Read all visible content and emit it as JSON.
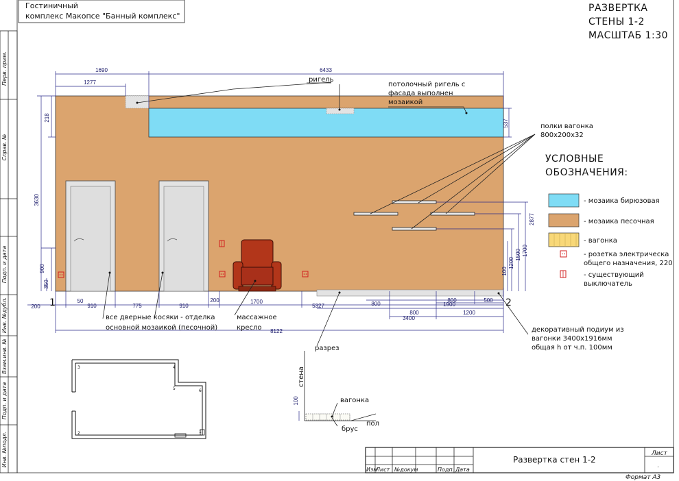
{
  "header": {
    "project_line1": "Гостиничный",
    "project_line2": "комплекс Макопсе \"Банный комплекс\"",
    "title_line1": "РАЗВЕРТКА",
    "title_line2": "СТЕНЫ 1-2",
    "title_line3": "МАСШТАБ 1:30"
  },
  "side_stamps": [
    "Перв. прим.",
    "Справ. №",
    "Подп. и дата",
    "Инв. №дубл.",
    "Взам.инв. №",
    "Подп. и дата",
    "Инв. №подл."
  ],
  "annotations": {
    "rigel": "ригель",
    "ceiling_line1": "потолочный ригель с",
    "ceiling_line2": "фасада выполнен",
    "ceiling_line3": "мозаикой",
    "shelves_line1": "полки вагонка",
    "shelves_line2": "800х200х32",
    "doors_line1": "все дверные косяки - отделка",
    "doors_line2": "основной мозаикой (песочной)",
    "chair_line1": "массажное",
    "chair_line2": "кресло",
    "podium_line1": "декоративный подиум из",
    "podium_line2": "вагонки 3400х1916мм",
    "podium_line3": "общая h от ч.п. 100мм",
    "section_label": "разрез",
    "section_wall": "стена",
    "section_lining": "вагонка",
    "section_beam": "брус",
    "section_floor": "пол",
    "section_100": "100",
    "point1": "1",
    "point2": "2"
  },
  "legend": {
    "title_line1": "УСЛОВНЫЕ",
    "title_line2": "ОБОЗНАЧЕНИЯ:",
    "items": [
      {
        "label": "- мозаика бирюзовая",
        "color": "#7fdcf5"
      },
      {
        "label": "- мозаика песочная",
        "color": "#dba46e"
      },
      {
        "label": "- вагонка",
        "color": "#f8d878"
      }
    ],
    "socket_line1": "- розетка электрическа",
    "socket_line2": "общего назначения, 220",
    "switch_line1": "- существующий",
    "switch_line2": "выключатель"
  },
  "dimensions": {
    "d1690": "1690",
    "d6433": "6433",
    "d1277": "1277",
    "d218": "218",
    "d537": "537",
    "d3630": "3630",
    "d900": "900",
    "d350": "350",
    "d200a": "200",
    "d50": "50",
    "d910a": "910",
    "d775": "775",
    "d910b": "910",
    "d200b": "200",
    "d1700": "1700",
    "d5327": "5327",
    "d8122": "8122",
    "d800a": "800",
    "d800b": "800",
    "d800c": "800",
    "d500": "500",
    "d1900": "1900",
    "d1200": "1200",
    "d3400": "3400",
    "d2877": "2877",
    "d1700v": "1700",
    "d1500": "1500",
    "d1200v": "1200",
    "d100": "100"
  },
  "plan_numbers": [
    "1",
    "2",
    "3",
    "4",
    "5",
    "6"
  ],
  "stamp": {
    "title": "Развертка стен 1-2",
    "sheet": "Лист",
    "cols": [
      "Изм",
      "Лист",
      "№докум",
      "Подп.",
      "Дата"
    ],
    "format": "Формат А3",
    "dot": "."
  },
  "colors": {
    "turquoise": "#7fdcf5",
    "sand": "#dba46e",
    "lining": "#f8d878",
    "chair": "#b2361a",
    "socket": "#d21e1e"
  }
}
